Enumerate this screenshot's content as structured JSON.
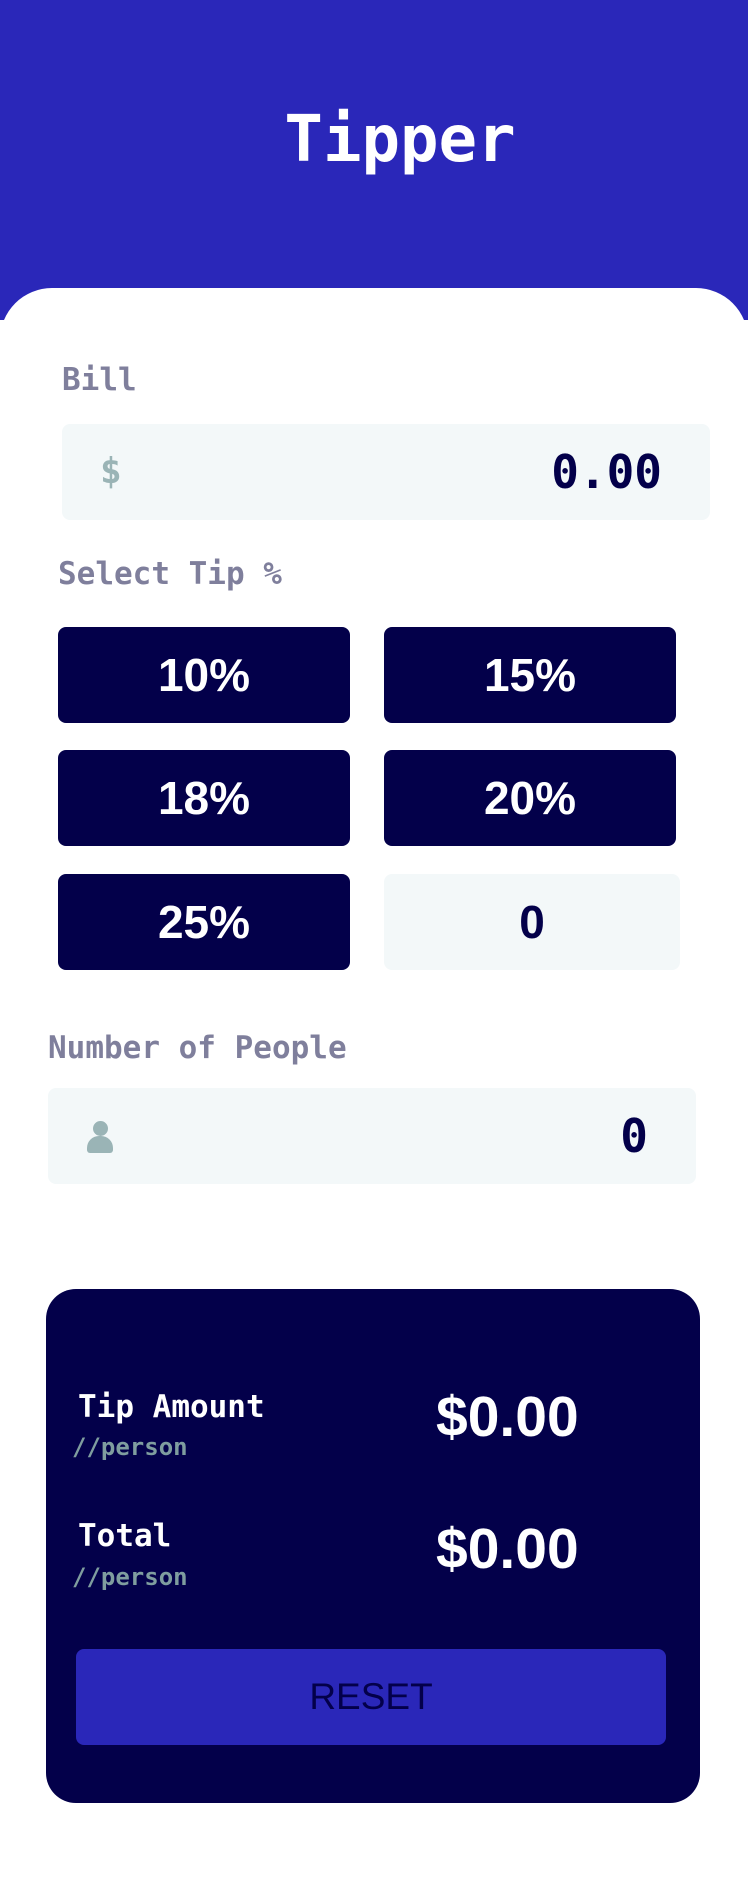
{
  "app": {
    "title": "Tipper"
  },
  "bill": {
    "label": "Bill",
    "currency_symbol": "$",
    "value": "0.00"
  },
  "tip": {
    "label": "Select Tip %",
    "options": [
      "10%",
      "15%",
      "18%",
      "20%",
      "25%"
    ],
    "custom_value": "0"
  },
  "people": {
    "label": "Number of People",
    "icon": "person-icon",
    "value": "0"
  },
  "results": {
    "tip_amount": {
      "label": "Tip Amount",
      "sub": "//person",
      "value": "$0.00"
    },
    "total": {
      "label": "Total",
      "sub": "//person",
      "value": "$0.00"
    },
    "reset_label": "RESET"
  },
  "colors": {
    "header": "#2a27b9",
    "dark": "#03004a",
    "input_bg": "#f3f8f9",
    "label": "#7f7f9c",
    "muted": "#9ab4b6"
  }
}
